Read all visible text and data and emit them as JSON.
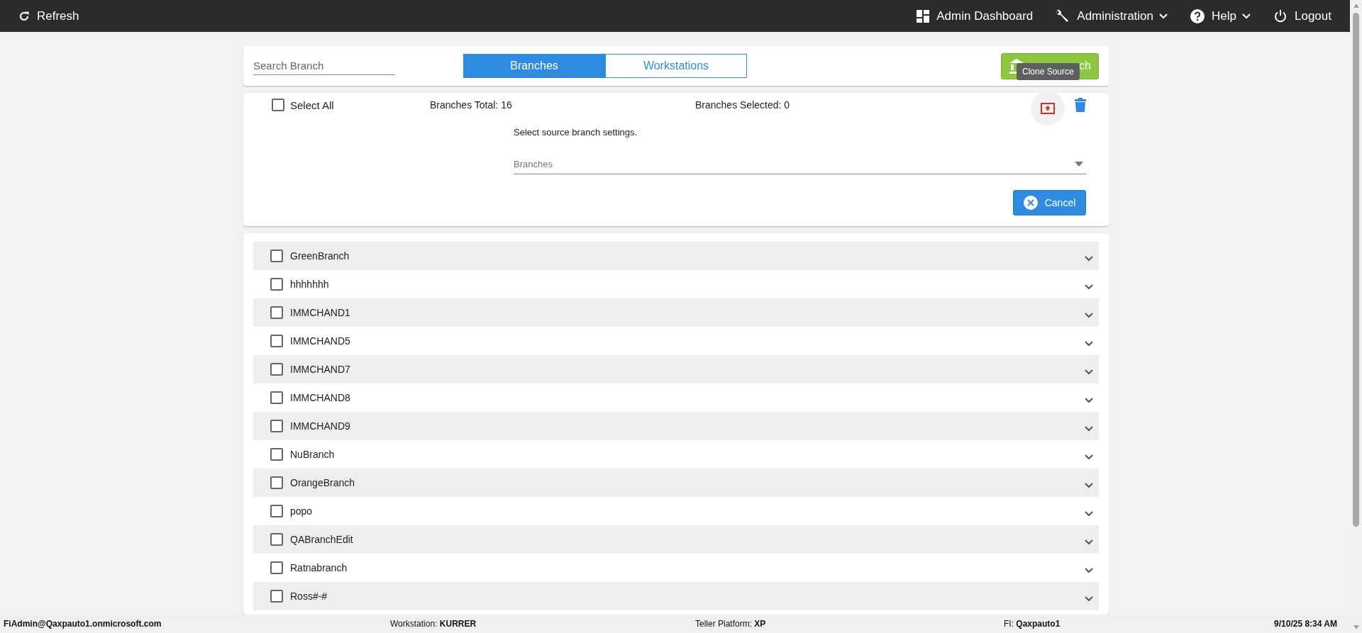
{
  "top_bar": {
    "refresh": "Refresh",
    "menu": [
      {
        "label": "Admin Dashboard",
        "kind": "link"
      },
      {
        "label": "Administration",
        "kind": "dropdown"
      },
      {
        "label": "Help",
        "kind": "dropdown"
      },
      {
        "label": "Logout",
        "kind": "link"
      }
    ]
  },
  "toolbar": {
    "search": {
      "placeholder": "Search Branch"
    },
    "tabs": [
      {
        "label": "Branches",
        "selected": true
      },
      {
        "label": "Workstations",
        "selected": false
      }
    ],
    "new_button": {
      "label_visible": "ch"
    },
    "tooltip": "Clone Source"
  },
  "summary": {
    "select_all": {
      "label": "Select All",
      "checked": false
    },
    "total": "Branches Total: 16",
    "selected_count": "Branches Selected: 0"
  },
  "clone_panel": {
    "prompt": "Select source branch settings.",
    "dropdown": {
      "placeholder": "Branches"
    },
    "cancel": "Cancel"
  },
  "branches": [
    {
      "name": "GreenBranch",
      "checked": false
    },
    {
      "name": "hhhhhhh",
      "checked": false
    },
    {
      "name": "IMMCHAND1",
      "checked": false
    },
    {
      "name": "IMMCHAND5",
      "checked": false
    },
    {
      "name": "IMMCHAND7",
      "checked": false
    },
    {
      "name": "IMMCHAND8",
      "checked": false
    },
    {
      "name": "IMMCHAND9",
      "checked": false
    },
    {
      "name": "NuBranch",
      "checked": false
    },
    {
      "name": "OrangeBranch",
      "checked": false
    },
    {
      "name": "popo",
      "checked": false
    },
    {
      "name": "QABranchEdit",
      "checked": false
    },
    {
      "name": "Ratnabranch",
      "checked": false
    },
    {
      "name": "Ross#-#",
      "checked": false
    }
  ],
  "status_bar": {
    "user": "FiAdmin@Qaxpauto1.onmicrosoft.com",
    "fields": [
      {
        "label": "Workstation:",
        "value": "KURRER"
      },
      {
        "label": "Teller Platform:",
        "value": "XP"
      },
      {
        "label": "FI:",
        "value": "Qaxpauto1"
      }
    ],
    "datetime": "9/10/25 8:34 AM"
  }
}
